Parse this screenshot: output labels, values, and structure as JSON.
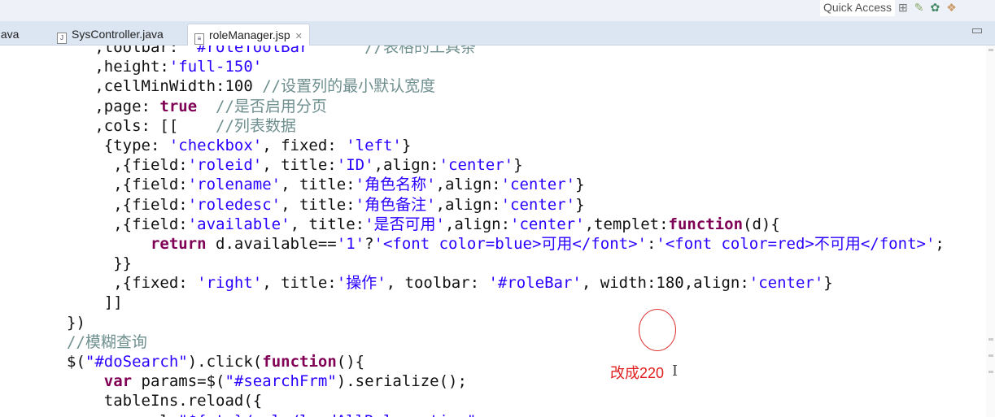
{
  "toolbar": {
    "quick_access": "Quick Access",
    "icons": [
      "perspective-icon",
      "git-icon",
      "debug-icon",
      "java-icon"
    ]
  },
  "tabs": [
    {
      "label": "r.java",
      "icon": "java-file-icon"
    },
    {
      "label": "SysController.java",
      "icon": "java-file-icon"
    },
    {
      "label": "roleManager.jsp",
      "icon": "jsp-file-icon",
      "active": true
    }
  ],
  "colors": {
    "keyword": "#7f0055",
    "string": "#2a00ff",
    "comment": "#6f8f8f",
    "annotation": "#e02020"
  },
  "code": {
    "lines": [
      [
        [
          "",
          "   ,toolbar: "
        ],
        [
          "str",
          "'#roleToolBar'"
        ],
        [
          "",
          "     "
        ],
        [
          "cm",
          "//表格的工具条"
        ]
      ],
      [
        [
          "",
          "   ,height:"
        ],
        [
          "str",
          "'full-150'"
        ]
      ],
      [
        [
          "",
          "   ,cellMinWidth:100 "
        ],
        [
          "cm",
          "//设置列的最小默认宽度"
        ]
      ],
      [
        [
          "",
          "   ,page: "
        ],
        [
          "kw",
          "true"
        ],
        [
          "",
          "  "
        ],
        [
          "cm",
          "//是否启用分页"
        ]
      ],
      [
        [
          "",
          "   ,cols: [[    "
        ],
        [
          "cm",
          "//列表数据"
        ]
      ],
      [
        [
          "",
          "    {type: "
        ],
        [
          "str",
          "'checkbox'"
        ],
        [
          "",
          ", fixed: "
        ],
        [
          "str",
          "'left'"
        ],
        [
          "",
          "}"
        ]
      ],
      [
        [
          "",
          "     ,{field:"
        ],
        [
          "str",
          "'roleid'"
        ],
        [
          "",
          ", title:"
        ],
        [
          "str",
          "'ID'"
        ],
        [
          "",
          ",align:"
        ],
        [
          "str",
          "'center'"
        ],
        [
          "",
          "}"
        ]
      ],
      [
        [
          "",
          "     ,{field:"
        ],
        [
          "str",
          "'rolename'"
        ],
        [
          "",
          ", title:"
        ],
        [
          "str",
          "'角色名称'"
        ],
        [
          "",
          ",align:"
        ],
        [
          "str",
          "'center'"
        ],
        [
          "",
          "}"
        ]
      ],
      [
        [
          "",
          "     ,{field:"
        ],
        [
          "str",
          "'roledesc'"
        ],
        [
          "",
          ", title:"
        ],
        [
          "str",
          "'角色备注'"
        ],
        [
          "",
          ",align:"
        ],
        [
          "str",
          "'center'"
        ],
        [
          "",
          "}"
        ]
      ],
      [
        [
          "",
          "     ,{field:"
        ],
        [
          "str",
          "'available'"
        ],
        [
          "",
          ", title:"
        ],
        [
          "str",
          "'是否可用'"
        ],
        [
          "",
          ",align:"
        ],
        [
          "str",
          "'center'"
        ],
        [
          "",
          ",templet:"
        ],
        [
          "kw",
          "function"
        ],
        [
          "",
          "(d){"
        ]
      ],
      [
        [
          "",
          "         "
        ],
        [
          "kw",
          "return"
        ],
        [
          "",
          " d.available=="
        ],
        [
          "str",
          "'1'"
        ],
        [
          "",
          "?"
        ],
        [
          "str",
          "'<font color=blue>可用</font>'"
        ],
        [
          "",
          ":"
        ],
        [
          "str",
          "'<font color=red>不可用</font>'"
        ],
        [
          "",
          ";"
        ]
      ],
      [
        [
          "",
          "     }}"
        ]
      ],
      [
        [
          "",
          "     ,{fixed: "
        ],
        [
          "str",
          "'right'"
        ],
        [
          "",
          ", title:"
        ],
        [
          "str",
          "'操作'"
        ],
        [
          "",
          ", toolbar: "
        ],
        [
          "str",
          "'#roleBar'"
        ],
        [
          "",
          ", width:180,align:"
        ],
        [
          "str",
          "'center'"
        ],
        [
          "",
          "}"
        ]
      ],
      [
        [
          "",
          "    ]]"
        ]
      ],
      [
        [
          "",
          "})"
        ]
      ],
      [
        [
          "cm",
          "//模糊查询"
        ]
      ],
      [
        [
          "",
          "$("
        ],
        [
          "str",
          "\"#doSearch\""
        ],
        [
          "",
          ").click("
        ],
        [
          "kw",
          "function"
        ],
        [
          "",
          "(){"
        ]
      ],
      [
        [
          "",
          "    "
        ],
        [
          "kw",
          "var"
        ],
        [
          "",
          " params=$("
        ],
        [
          "str",
          "\"#searchFrm\""
        ],
        [
          "",
          ").serialize();"
        ]
      ],
      [
        [
          "",
          "    tableIns.reload({"
        ]
      ],
      [
        [
          "",
          "        url:"
        ],
        [
          "str",
          "\"${ctx}/role/loadAllRole.action\""
        ]
      ]
    ]
  },
  "annotation": {
    "text": "改成220",
    "circled_value": "180"
  }
}
